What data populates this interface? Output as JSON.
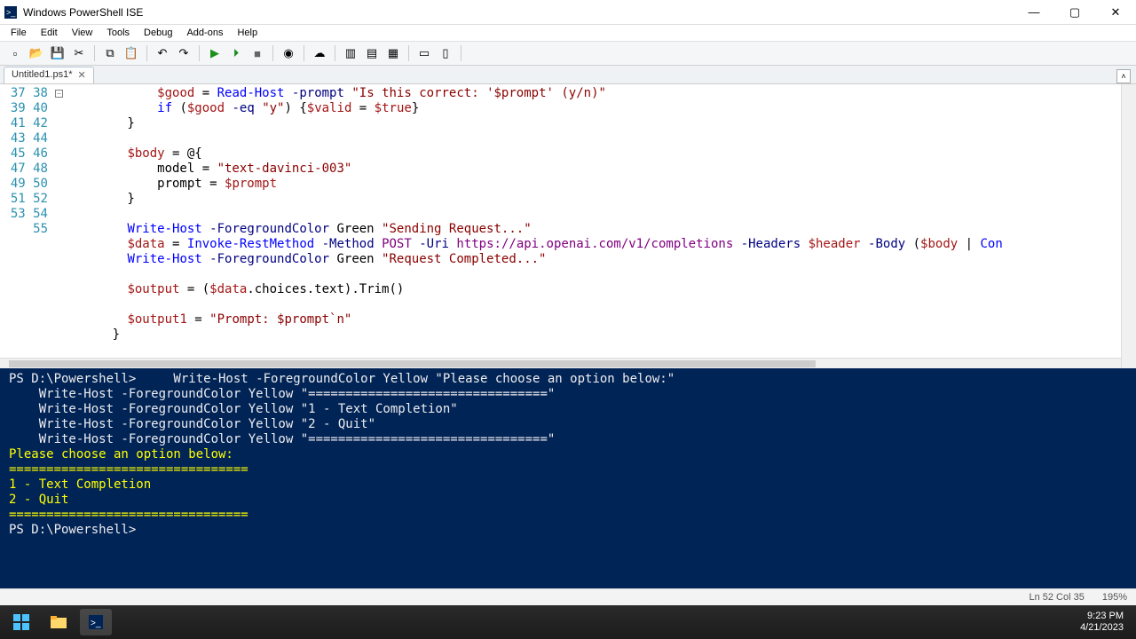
{
  "window": {
    "title": "Windows PowerShell ISE"
  },
  "menu": [
    "File",
    "Edit",
    "View",
    "Tools",
    "Debug",
    "Add-ons",
    "Help"
  ],
  "tab": {
    "name": "Untitled1.ps1*",
    "close": "✕"
  },
  "wincontrols": {
    "minimize": "—",
    "maximize": "▢",
    "close": "✕"
  },
  "editor": {
    "first_line": 37,
    "lines": [
      {
        "n": 37,
        "html": "            <span class='var'>$good</span> = <span class='cmd'>Read-Host</span> <span class='param'>-prompt</span> <span class='str'>\"Is this correct: '$prompt' (y/n)\"</span>"
      },
      {
        "n": 38,
        "html": "            <span class='cmd'>if</span> (<span class='var'>$good</span> <span class='param'>-eq</span> <span class='str'>\"y\"</span>) {<span class='var'>$valid</span> = <span class='var'>$true</span>}"
      },
      {
        "n": 39,
        "html": "        }"
      },
      {
        "n": 40,
        "html": ""
      },
      {
        "n": 41,
        "html": "        <span class='var'>$body</span> = @{",
        "fold": true
      },
      {
        "n": 42,
        "html": "            model = <span class='str'>\"text-davinci-003\"</span>"
      },
      {
        "n": 43,
        "html": "            prompt = <span class='var'>$prompt</span>"
      },
      {
        "n": 44,
        "html": "        }"
      },
      {
        "n": 45,
        "html": ""
      },
      {
        "n": 46,
        "html": "        <span class='cmd'>Write-Host</span> <span class='param'>-ForegroundColor</span> Green <span class='str'>\"Sending Request...\"</span>"
      },
      {
        "n": 47,
        "html": "        <span class='var'>$data</span> = <span class='cmd'>Invoke-RestMethod</span> <span class='param'>-Method</span> <span class='num'>POST</span> <span class='param'>-Uri</span> <span class='num'>https://api.openai.com/v1/completions</span> <span class='param'>-Headers</span> <span class='var'>$header</span> <span class='param'>-Body</span> (<span class='var'>$body</span> | <span class='cmd'>Con</span>"
      },
      {
        "n": 48,
        "html": "        <span class='cmd'>Write-Host</span> <span class='param'>-ForegroundColor</span> Green <span class='str'>\"Request Completed...\"</span>"
      },
      {
        "n": 49,
        "html": ""
      },
      {
        "n": 50,
        "html": "        <span class='var'>$output</span> = (<span class='var'>$data</span>.choices.text).Trim()"
      },
      {
        "n": 51,
        "html": ""
      },
      {
        "n": 52,
        "html": "        <span class='var'>$output1</span> = <span class='str'>\"Prompt: $prompt`n\"</span>"
      },
      {
        "n": 53,
        "html": "      }"
      },
      {
        "n": 54,
        "html": ""
      },
      {
        "n": 55,
        "html": "  }"
      }
    ]
  },
  "console": {
    "lines": [
      {
        "html": "PS D:\\Powershell&gt;     Write-Host -ForegroundColor Yellow \"Please choose an option below:\""
      },
      {
        "html": "    Write-Host -ForegroundColor Yellow \"================================\""
      },
      {
        "html": "    Write-Host -ForegroundColor Yellow \"1 - Text Completion\""
      },
      {
        "html": "    Write-Host -ForegroundColor Yellow \"2 - Quit\""
      },
      {
        "html": "    Write-Host -ForegroundColor Yellow \"================================\""
      },
      {
        "class": "yel",
        "html": "Please choose an option below:"
      },
      {
        "class": "yel",
        "html": "================================"
      },
      {
        "class": "yel",
        "html": "1 - Text Completion"
      },
      {
        "class": "yel",
        "html": "2 - Quit"
      },
      {
        "class": "yel",
        "html": "================================"
      },
      {
        "html": ""
      },
      {
        "html": "PS D:\\Powershell&gt; "
      }
    ]
  },
  "status": {
    "pos": "Ln 52  Col 35",
    "zoom": "195%"
  },
  "clock": {
    "time": "9:23 PM",
    "date": "4/21/2023"
  },
  "toolbar_icons": [
    "new-icon",
    "open-icon",
    "save-icon",
    "cut-icon",
    "",
    "copy-icon",
    "paste-icon",
    "",
    "undo-icon",
    "redo-icon",
    "",
    "run-icon",
    "run-selection-icon",
    "stop-icon",
    "",
    "breakpoint-icon",
    "",
    "remote-icon",
    "",
    "pane-icon",
    "pane2-icon",
    "pane3-icon",
    "",
    "toggle1-icon",
    "toggle2-icon",
    ""
  ]
}
